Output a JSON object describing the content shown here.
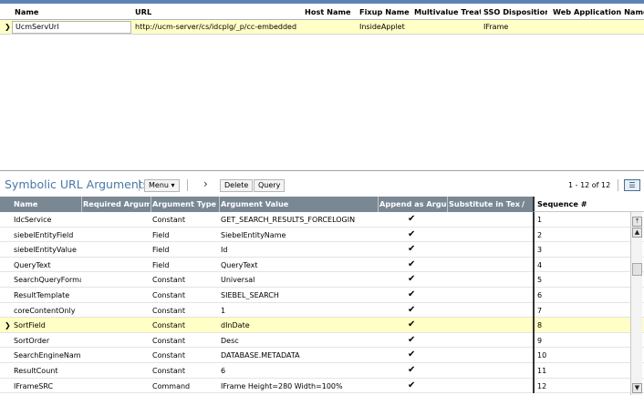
{
  "top_applet": {
    "columns": [
      "Name",
      "URL",
      "Host Name",
      "Fixup Name",
      "Multivalue Treatm",
      "SSO Disposition",
      "Web Application Name"
    ],
    "record": {
      "name": "UcmServUrl",
      "url": "http://ucm-server/cs/idcplg/_p/cc-embedded",
      "host_name": "",
      "fixup_name": "InsideApplet",
      "multivalue_treatment": "",
      "sso_disposition": "IFrame",
      "web_application_name": ""
    }
  },
  "bottom_applet": {
    "title": "Symbolic URL Arguments",
    "menu_label": "Menu ▾",
    "nav_next": "›",
    "delete_label": "Delete",
    "query_label": "Query",
    "record_count": "1 - 12 of 12",
    "columns": [
      "Name",
      "Required Argume",
      "Argument Type",
      "Argument Value",
      "Append as Argun",
      "Substitute in Text",
      "Sequence #"
    ],
    "sort_indicator": "∕",
    "rows": [
      {
        "name": "IdcService",
        "required": "",
        "type": "Constant",
        "value": "GET_SEARCH_RESULTS_FORCELOGIN",
        "append": "✔",
        "substitute": "",
        "seq": "1"
      },
      {
        "name": "siebelEntityField",
        "required": "",
        "type": "Field",
        "value": "SiebelEntityName",
        "append": "✔",
        "substitute": "",
        "seq": "2"
      },
      {
        "name": "siebelEntityValue",
        "required": "",
        "type": "Field",
        "value": "Id",
        "append": "✔",
        "substitute": "",
        "seq": "3"
      },
      {
        "name": "QueryText",
        "required": "",
        "type": "Field",
        "value": "QueryText",
        "append": "✔",
        "substitute": "",
        "seq": "4"
      },
      {
        "name": "SearchQueryFormat",
        "required": "",
        "type": "Constant",
        "value": "Universal",
        "append": "✔",
        "substitute": "",
        "seq": "5"
      },
      {
        "name": "ResultTemplate",
        "required": "",
        "type": "Constant",
        "value": "SIEBEL_SEARCH",
        "append": "✔",
        "substitute": "",
        "seq": "6"
      },
      {
        "name": "coreContentOnly",
        "required": "",
        "type": "Constant",
        "value": "1",
        "append": "✔",
        "substitute": "",
        "seq": "7"
      },
      {
        "name": "SortField",
        "required": "",
        "type": "Constant",
        "value": "dInDate",
        "append": "✔",
        "substitute": "",
        "seq": "8"
      },
      {
        "name": "SortOrder",
        "required": "",
        "type": "Constant",
        "value": "Desc",
        "append": "✔",
        "substitute": "",
        "seq": "9"
      },
      {
        "name": "SearchEngineName",
        "required": "",
        "type": "Constant",
        "value": "DATABASE.METADATA",
        "append": "✔",
        "substitute": "",
        "seq": "10"
      },
      {
        "name": "ResultCount",
        "required": "",
        "type": "Constant",
        "value": "6",
        "append": "✔",
        "substitute": "",
        "seq": "11"
      },
      {
        "name": "IFrameSRC",
        "required": "",
        "type": "Command",
        "value": "IFrame Height=280 Width=100%",
        "append": "✔",
        "substitute": "",
        "seq": "12"
      }
    ],
    "selected_row": 7,
    "row_arrow": "❯",
    "scroll_top_label": "⤒",
    "scroll_up_label": "▲",
    "scroll_down_label": "▼",
    "colors": {
      "title": "#4a78a8",
      "header_bg": "#7a8894",
      "selected_row_bg": "#ffffc6"
    }
  },
  "top_row_arrow": "❯",
  "applet_menu_icon": "☰"
}
